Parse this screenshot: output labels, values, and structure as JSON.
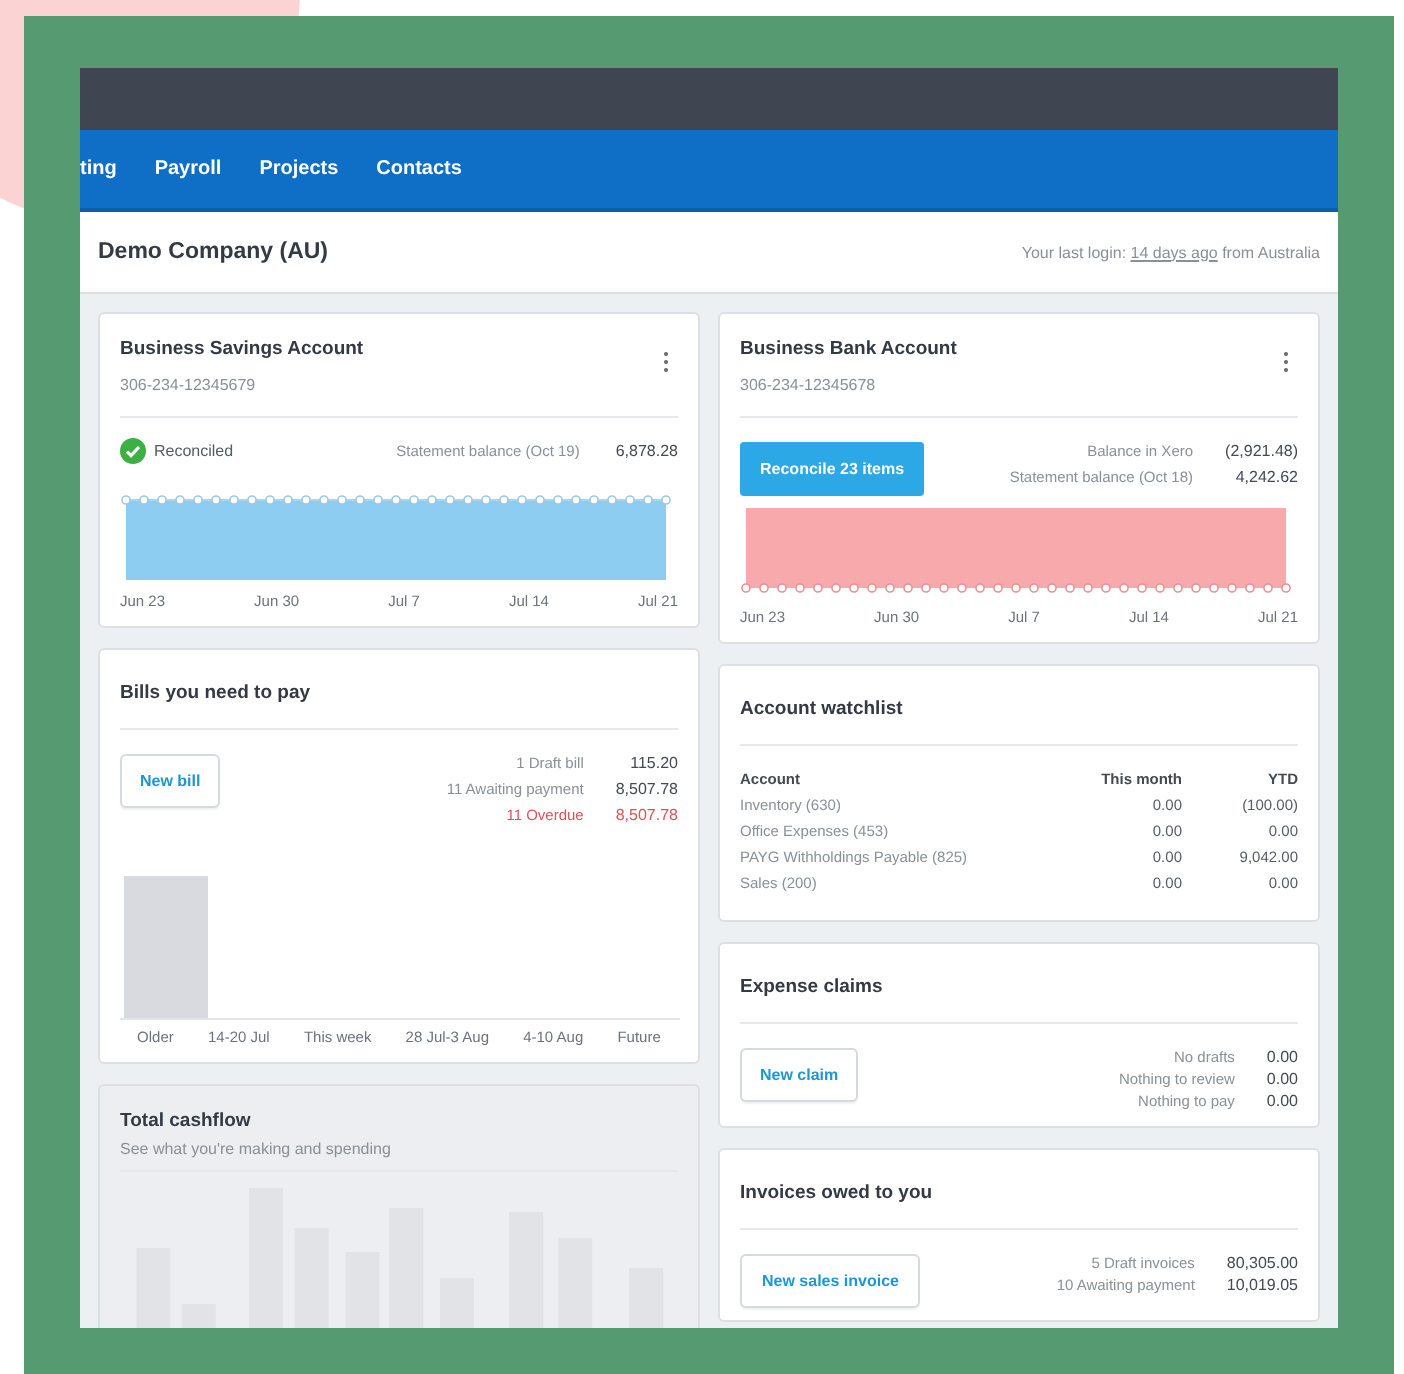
{
  "nav": {
    "items": [
      "ting",
      "Payroll",
      "Projects",
      "Contacts"
    ]
  },
  "header": {
    "company": "Demo Company (AU)",
    "login_prefix": "Your last login:",
    "login_link": "14 days ago",
    "login_suffix": "from Australia"
  },
  "savings_account": {
    "title": "Business Savings Account",
    "number": "306-234-12345679",
    "status": "Reconciled",
    "balance_label": "Statement balance (Oct 19)",
    "balance_value": "6,878.28",
    "x_labels": [
      "Jun 23",
      "Jun 30",
      "Jul 7",
      "Jul 14",
      "Jul 21"
    ]
  },
  "bank_account": {
    "title": "Business Bank Account",
    "number": "306-234-12345678",
    "button": "Reconcile 23 items",
    "rows": [
      {
        "label": "Balance in Xero",
        "value": "(2,921.48)"
      },
      {
        "label": "Statement balance (Oct 18)",
        "value": "4,242.62"
      }
    ],
    "x_labels": [
      "Jun 23",
      "Jun 30",
      "Jul 7",
      "Jul 14",
      "Jul 21"
    ]
  },
  "bills": {
    "title": "Bills you need to pay",
    "button": "New bill",
    "rows": [
      {
        "label": "1 Draft bill",
        "value": "115.20",
        "overdue": false
      },
      {
        "label": "11 Awaiting payment",
        "value": "8,507.78",
        "overdue": false
      },
      {
        "label": "11 Overdue",
        "value": "8,507.78",
        "overdue": true
      }
    ],
    "x_labels": [
      "Older",
      "14-20 Jul",
      "This week",
      "28 Jul-3 Aug",
      "4-10 Aug",
      "Future"
    ]
  },
  "watchlist": {
    "title": "Account watchlist",
    "columns": [
      "Account",
      "This month",
      "YTD"
    ],
    "rows": [
      [
        "Inventory (630)",
        "0.00",
        "(100.00)"
      ],
      [
        "Office Expenses (453)",
        "0.00",
        "0.00"
      ],
      [
        "PAYG Withholdings Payable (825)",
        "0.00",
        "9,042.00"
      ],
      [
        "Sales (200)",
        "0.00",
        "0.00"
      ]
    ]
  },
  "expense_claims": {
    "title": "Expense claims",
    "button": "New claim",
    "rows": [
      {
        "label": "No drafts",
        "value": "0.00"
      },
      {
        "label": "Nothing to review",
        "value": "0.00"
      },
      {
        "label": "Nothing to pay",
        "value": "0.00"
      }
    ]
  },
  "cashflow": {
    "title": "Total cashflow",
    "subtitle": "See what you're making and spending"
  },
  "invoices": {
    "title": "Invoices owed to you",
    "button": "New sales invoice",
    "rows": [
      {
        "label": "5 Draft invoices",
        "value": "80,305.00"
      },
      {
        "label": "10 Awaiting payment",
        "value": "10,019.05"
      }
    ]
  }
}
